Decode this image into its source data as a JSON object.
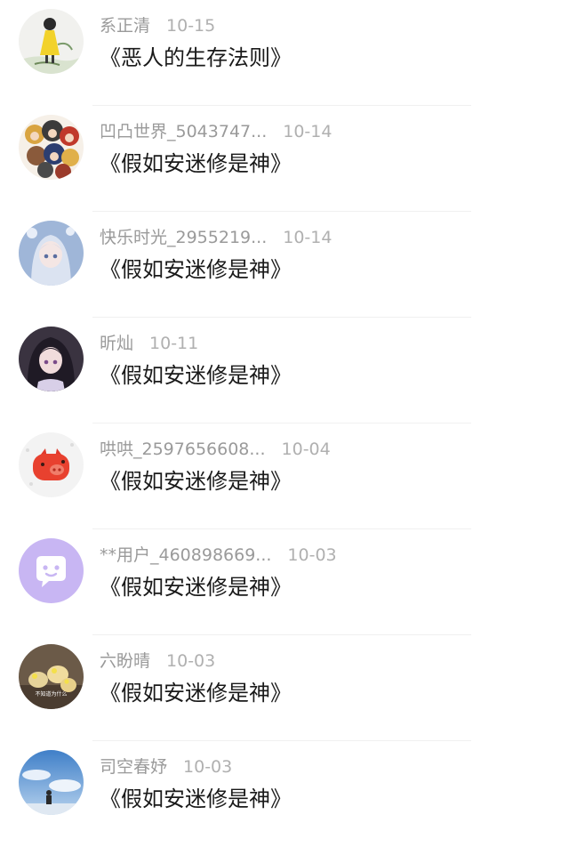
{
  "entries": [
    {
      "username": "系正清",
      "date": "10-15",
      "title": "《恶人的生存法则》",
      "avatar": "avatar-girl-yellow-dress"
    },
    {
      "username": "凹凸世界_5043747...",
      "date": "10-14",
      "title": "《假如安迷修是神》",
      "avatar": "avatar-anime-group"
    },
    {
      "username": "快乐时光_2955219...",
      "date": "10-14",
      "title": "《假如安迷修是神》",
      "avatar": "avatar-anime-silver-hair"
    },
    {
      "username": "昕灿",
      "date": "10-11",
      "title": "《假如安迷修是神》",
      "avatar": "avatar-anime-dark-hair"
    },
    {
      "username": "哄哄_2597656608...",
      "date": "10-04",
      "title": "《假如安迷修是神》",
      "avatar": "avatar-red-pig"
    },
    {
      "username": "**用户_460898669...",
      "date": "10-03",
      "title": "《假如安迷修是神》",
      "avatar": "avatar-default-chat"
    },
    {
      "username": "六盼晴",
      "date": "10-03",
      "title": "《假如安迷修是神》",
      "avatar": "avatar-photo-chicks",
      "avatar_caption": "不知道为什么"
    },
    {
      "username": "司空春妤",
      "date": "10-03",
      "title": "《假如安迷修是神》",
      "avatar": "avatar-photo-sky"
    }
  ],
  "colors": {
    "username": "#9a9a9a",
    "date": "#b0b0b0",
    "title": "#1a1a1a",
    "divider": "#f0f0f0",
    "default_avatar": "#c8b6f3"
  }
}
